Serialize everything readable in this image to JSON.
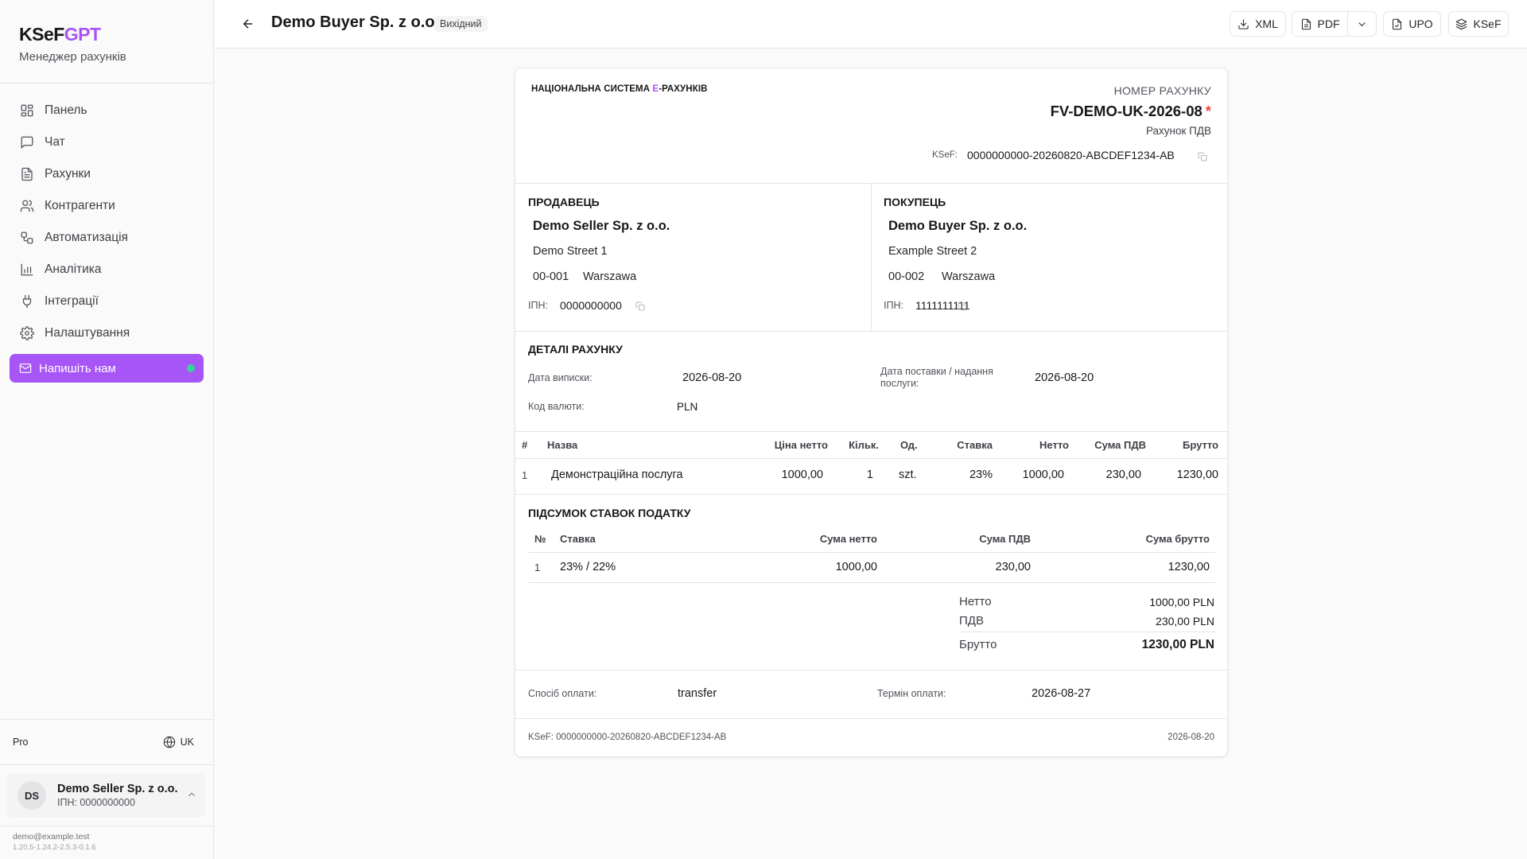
{
  "app": {
    "brand_main": "KSeF",
    "brand_accent": "GPT",
    "subtitle": "Менеджер рахунків",
    "accent_color": "#a855f7"
  },
  "sidebar": {
    "items": [
      {
        "label": "Панель",
        "icon": "dashboard-icon"
      },
      {
        "label": "Чат",
        "icon": "chat-icon"
      },
      {
        "label": "Рахунки",
        "icon": "invoice-icon"
      },
      {
        "label": "Контрагенти",
        "icon": "users-icon"
      },
      {
        "label": "Автоматизація",
        "icon": "workflow-icon"
      },
      {
        "label": "Аналітика",
        "icon": "chart-icon"
      },
      {
        "label": "Інтеграції",
        "icon": "plug-icon"
      },
      {
        "label": "Налаштування",
        "icon": "gear-icon"
      }
    ],
    "contact_label": "Напишіть нам",
    "plan": "Pro",
    "language": "UK",
    "user": {
      "initials": "DS",
      "name": "Demo Seller Sp. z o.o.",
      "nip": "ІПН: 0000000000"
    },
    "email": "demo@example.test",
    "version": "1.20.5-1.24.2-2.5.3-0.1.6"
  },
  "header": {
    "title": "Demo Buyer Sp. z o.o.",
    "badge": "Вихідний",
    "buttons": {
      "xml": "XML",
      "pdf": "PDF",
      "upo": "UPO",
      "ksef": "KSeF"
    }
  },
  "invoice": {
    "system_title_a": "НАЦІОНАЛЬНА СИСТЕМА ",
    "system_title_e": "E",
    "system_title_b": "-РАХУНКІВ",
    "number_label": "НОМЕР РАХУНКУ",
    "number": "FV-DEMO-UK-2026-08",
    "number_mark": "*",
    "type": "Рахунок ПДВ",
    "ksef_label": "KSeF:",
    "ksef_number": "0000000000-20260820-ABCDEF1234-AB",
    "seller": {
      "heading": "ПРОДАВЕЦЬ",
      "name": "Demo Seller Sp. z o.o.",
      "street": "Demo Street 1",
      "postal": "00-001",
      "city": "Warszawa",
      "nip_label": "ІПН:",
      "nip": "0000000000"
    },
    "buyer": {
      "heading": "ПОКУПЕЦЬ",
      "name": "Demo Buyer Sp. z o.o.",
      "street": "Example Street 2",
      "postal": "00-002",
      "city": "Warszawa",
      "nip_label": "ІПН:",
      "nip": "1111111111"
    },
    "details": {
      "heading": "ДЕТАЛІ РАХУНКУ",
      "issue_date_label": "Дата виписки:",
      "issue_date": "2026-08-20",
      "delivery_label_1": "Дата поставки / надання",
      "delivery_label_2": "послуги:",
      "delivery_date": "2026-08-20",
      "currency_label": "Код валюти:",
      "currency": "PLN"
    },
    "items_table": {
      "headers": [
        "#",
        "Назва",
        "Ціна нетто",
        "Кільк.",
        "Од.",
        "Ставка",
        "Нетто",
        "Сума ПДВ",
        "Брутто"
      ],
      "rows": [
        [
          "1",
          "Демонстраційна послуга",
          "1000,00",
          "1",
          "szt.",
          "23%",
          "1000,00",
          "230,00",
          "1230,00"
        ]
      ]
    },
    "tax_summary": {
      "heading": "ПІДСУМОК СТАВОК ПОДАТКУ",
      "headers": [
        "№",
        "Ставка",
        "Сума нетто",
        "Сума ПДВ",
        "Сума брутто"
      ],
      "rows": [
        [
          "1",
          "23% / 22%",
          "1000,00",
          "230,00",
          "1230,00"
        ]
      ]
    },
    "totals": {
      "net_label": "Нетто",
      "net": "1000,00 PLN",
      "vat_label": "ПДВ",
      "vat": "230,00 PLN",
      "gross_label": "Брутто",
      "gross": "1230,00 PLN"
    },
    "payment": {
      "method_label": "Спосіб оплати:",
      "method": "transfer",
      "due_label": "Термін оплати:",
      "due": "2026-08-27"
    },
    "footer": {
      "ksef": "KSeF: 0000000000-20260820-ABCDEF1234-AB",
      "date": "2026-08-20"
    }
  }
}
